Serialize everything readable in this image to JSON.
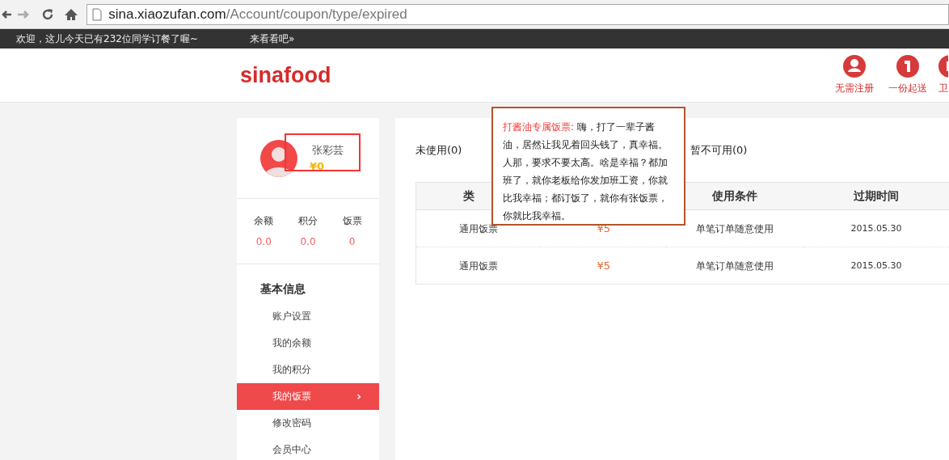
{
  "browser": {
    "url_host": "sina.xiaozufan.com",
    "url_path": "/Account/coupon/type/expired"
  },
  "topbar": {
    "welcome": "欢迎，这儿今天已有232位同学订餐了喔~",
    "link": "来看看吧»"
  },
  "header": {
    "logo": "sinafood",
    "features": [
      {
        "label": "无需注册",
        "kind": "user"
      },
      {
        "label": "一份起送",
        "kind": "one"
      },
      {
        "label": "卫",
        "kind": "shield"
      }
    ]
  },
  "profile": {
    "name": "张彩芸",
    "balance": "¥0",
    "stats": [
      {
        "label": "余额",
        "value": "0.0"
      },
      {
        "label": "积分",
        "value": "0.0"
      },
      {
        "label": "饭票",
        "value": "0"
      }
    ]
  },
  "menu": {
    "heading": "基本信息",
    "items": [
      {
        "label": "账户设置",
        "selected": false
      },
      {
        "label": "我的余额",
        "selected": false
      },
      {
        "label": "我的积分",
        "selected": false
      },
      {
        "label": "我的饭票",
        "selected": true,
        "arrow": "›"
      },
      {
        "label": "修改密码",
        "selected": false
      },
      {
        "label": "会员中心",
        "selected": false
      }
    ]
  },
  "tabs": [
    {
      "label": "未使用(0)"
    },
    {
      "label": "暂不可用(0)"
    }
  ],
  "table": {
    "columns": [
      "类",
      "",
      "使用条件",
      "过期时间"
    ],
    "rows": [
      {
        "type": "通用饭票",
        "amount": "¥5",
        "condition": "单笔订单随意使用",
        "expires": "2015.05.30"
      },
      {
        "type": "通用饭票",
        "amount": "¥5",
        "condition": "单笔订单随意使用",
        "expires": "2015.05.30"
      }
    ]
  },
  "popover": {
    "title": "打酱油专属饭票:",
    "text": "嗨，打了一辈子酱油，居然让我见着回头钱了，真幸福。人那，要求不要太高。啥是幸福？都加班了，就你老板给你发加班工资，你就比我幸福；都订饭了，就你有张饭票，你就比我幸福。"
  }
}
